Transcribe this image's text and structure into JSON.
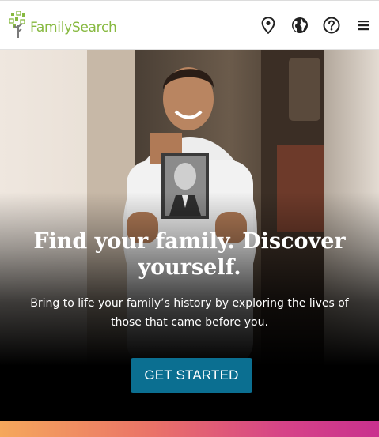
{
  "header": {
    "logo_text": "FamilySearch",
    "brand_color": "#87b940",
    "icons": [
      "location-pin-icon",
      "globe-icon",
      "help-icon",
      "menu-icon"
    ]
  },
  "hero": {
    "title": "Find your family. Discover yourself.",
    "subtitle": "Bring to life your family’s history by exploring the lives of those that came before you.",
    "cta_label": "GET STARTED",
    "cta_color": "#0b6f91"
  },
  "footer_band": {
    "gradient_colors": [
      "#f5a85c",
      "#ea7368",
      "#d64388",
      "#c9318e"
    ]
  }
}
